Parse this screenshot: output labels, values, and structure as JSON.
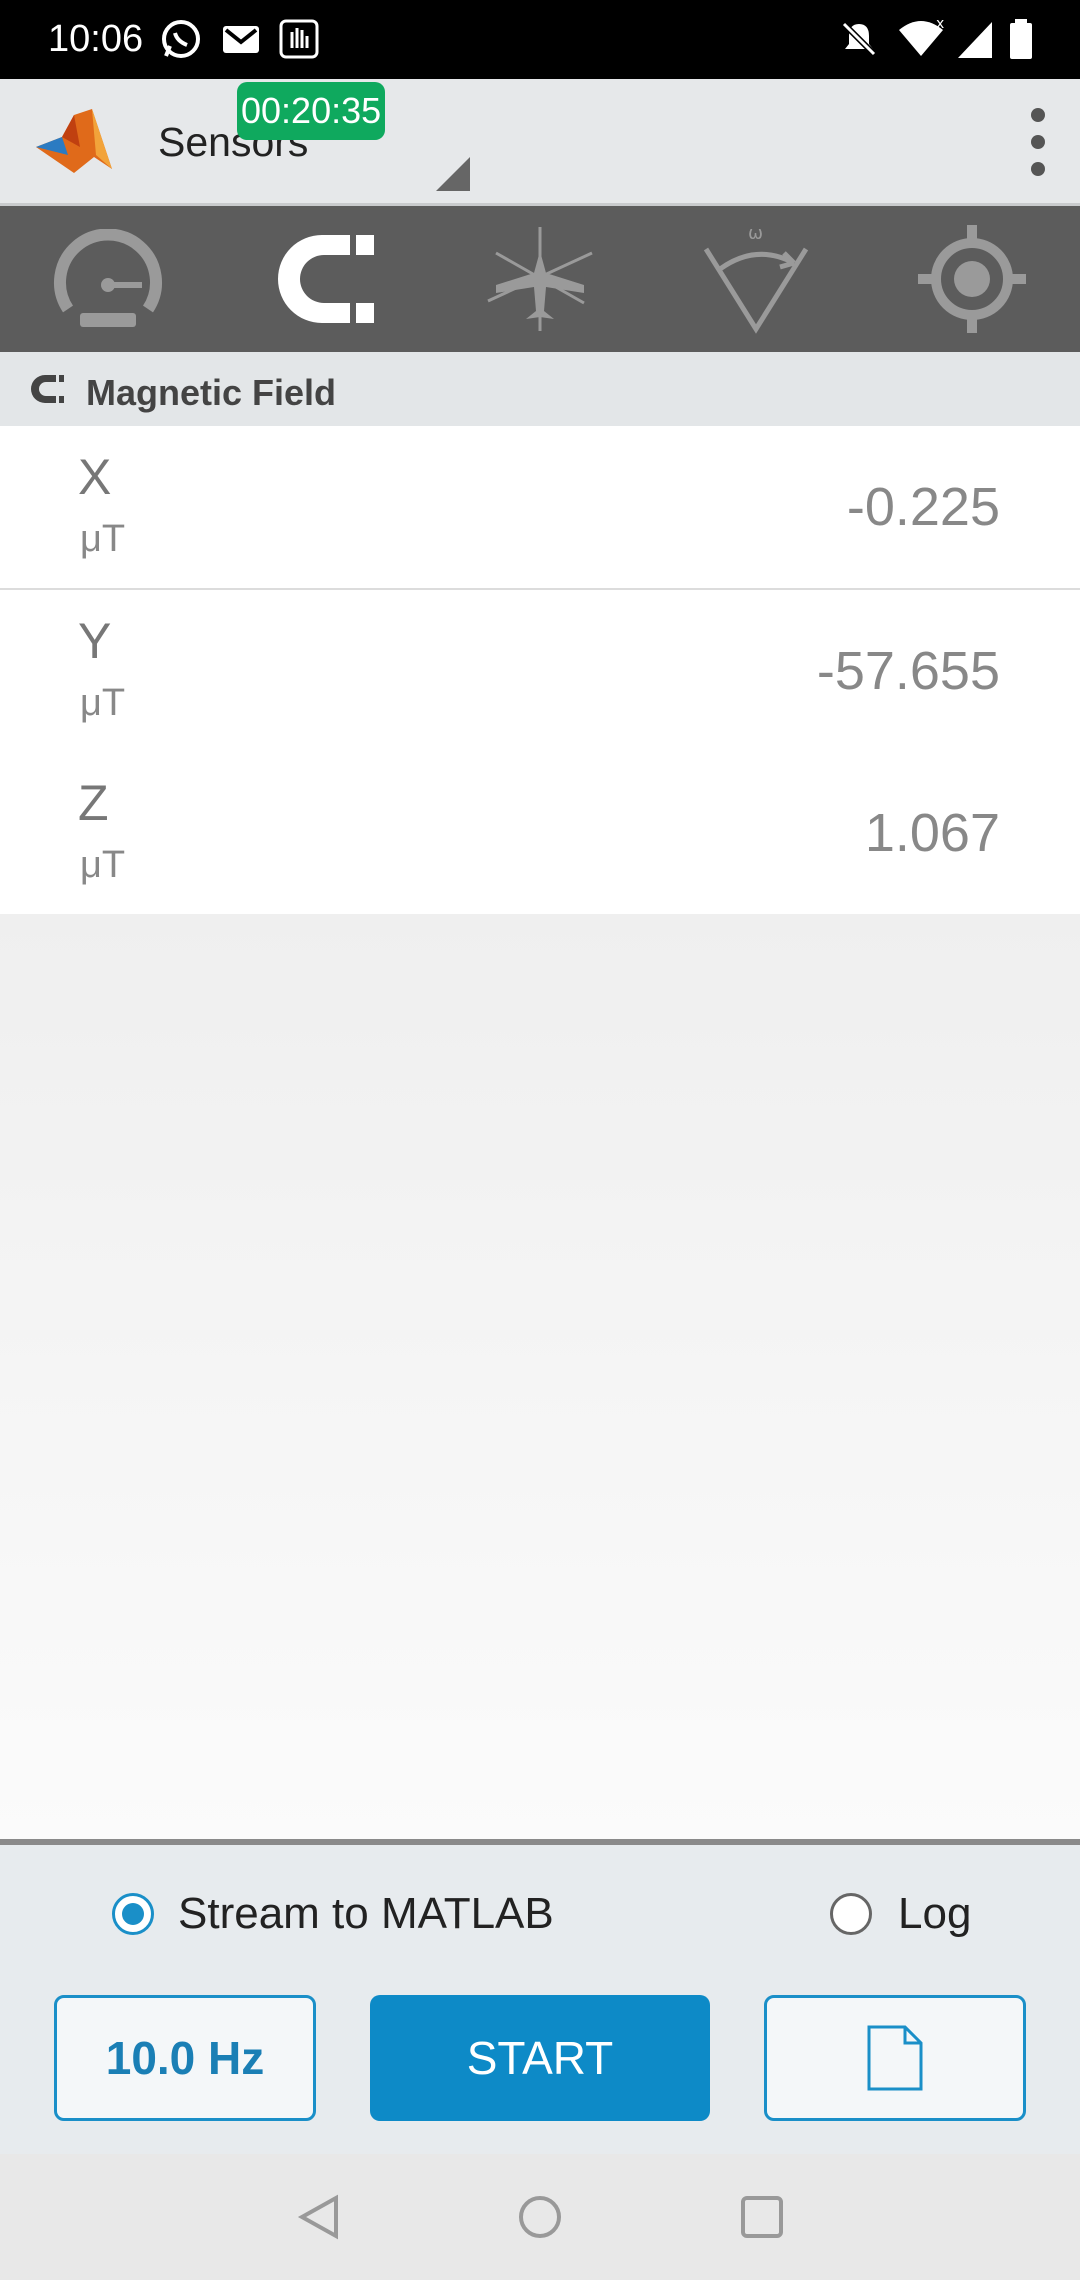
{
  "status_bar": {
    "time": "10:06",
    "icons": [
      "whatsapp-icon",
      "gmail-icon",
      "hand-notification-icon",
      "do-not-disturb-icon",
      "wifi-icon",
      "signal-icon",
      "battery-icon"
    ]
  },
  "app_bar": {
    "title": "Sensors",
    "timer": "00:20:35",
    "logo": "matlab-logo-icon",
    "menu_icon": "overflow-menu-icon"
  },
  "tabs": [
    {
      "name": "speedometer",
      "active": false
    },
    {
      "name": "magnet",
      "active": true
    },
    {
      "name": "airplane-orientation",
      "active": false
    },
    {
      "name": "angular-velocity",
      "active": false
    },
    {
      "name": "location",
      "active": false
    }
  ],
  "section": {
    "title": "Magnetic Field",
    "icon": "magnet-icon"
  },
  "readings": [
    {
      "axis": "X",
      "unit": "μT",
      "value": "-0.225"
    },
    {
      "axis": "Y",
      "unit": "μT",
      "value": "-57.655"
    },
    {
      "axis": "Z",
      "unit": "μT",
      "value": "1.067"
    }
  ],
  "bottom": {
    "stream_label": "Stream to MATLAB",
    "stream_selected": true,
    "log_label": "Log",
    "log_selected": false,
    "rate_label": "10.0 Hz",
    "start_label": "START",
    "file_icon": "file-icon"
  },
  "colors": {
    "accent": "#0d8ac7",
    "timer_green": "#0fa95e",
    "tab_bg": "#5c5c5c"
  }
}
